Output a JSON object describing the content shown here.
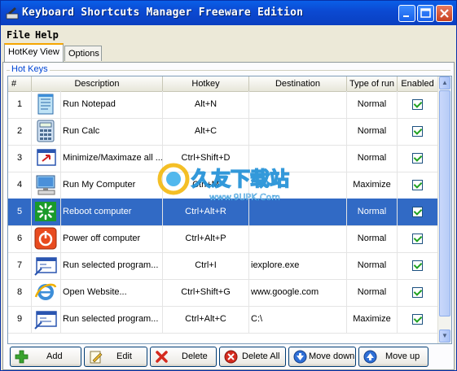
{
  "window": {
    "title": "Keyboard Shortcuts Manager Freeware Edition",
    "controls": [
      "minimize",
      "maximize",
      "close"
    ]
  },
  "menu": [
    {
      "label": "File"
    },
    {
      "label": "Help"
    }
  ],
  "tabs": [
    {
      "label": "HotKey View",
      "active": true
    },
    {
      "label": "Options",
      "active": false
    }
  ],
  "group": {
    "label": "Hot Keys"
  },
  "columns": [
    "#",
    "Description",
    "Hotkey",
    "Destination",
    "Type of run",
    "Enabled"
  ],
  "rows": [
    {
      "num": "1",
      "icon": "notepad-icon",
      "description": "Run Notepad",
      "hotkey": "Alt+N",
      "destination": "",
      "type": "Normal",
      "enabled": true,
      "selected": false
    },
    {
      "num": "2",
      "icon": "calculator-icon",
      "description": "Run Calc",
      "hotkey": "Alt+C",
      "destination": "",
      "type": "Normal",
      "enabled": true,
      "selected": false
    },
    {
      "num": "3",
      "icon": "minimize-window-icon",
      "description": "Minimize/Maximaze all ...",
      "hotkey": "Ctrl+Shift+D",
      "destination": "",
      "type": "Normal",
      "enabled": true,
      "selected": false
    },
    {
      "num": "4",
      "icon": "my-computer-icon",
      "description": "Run My Computer",
      "hotkey": "Ctrl+M",
      "destination": "",
      "type": "Maximize",
      "enabled": true,
      "selected": false
    },
    {
      "num": "5",
      "icon": "reboot-icon",
      "description": "Reboot computer",
      "hotkey": "Ctrl+Alt+R",
      "destination": "",
      "type": "Normal",
      "enabled": true,
      "selected": true
    },
    {
      "num": "6",
      "icon": "power-off-icon",
      "description": "Power off computer",
      "hotkey": "Ctrl+Alt+P",
      "destination": "",
      "type": "Normal",
      "enabled": true,
      "selected": false
    },
    {
      "num": "7",
      "icon": "run-program-icon",
      "description": "Run selected program...",
      "hotkey": "Ctrl+I",
      "destination": "iexplore.exe",
      "type": "Normal",
      "enabled": true,
      "selected": false
    },
    {
      "num": "8",
      "icon": "internet-explorer-icon",
      "description": "Open Website...",
      "hotkey": "Ctrl+Shift+G",
      "destination": "www.google.com",
      "type": "Normal",
      "enabled": true,
      "selected": false
    },
    {
      "num": "9",
      "icon": "run-program-icon",
      "description": "Run selected program...",
      "hotkey": "Ctrl+Alt+C",
      "destination": "C:\\",
      "type": "Maximize",
      "enabled": true,
      "selected": false
    }
  ],
  "buttons": [
    {
      "label": "Add",
      "icon": "add-icon"
    },
    {
      "label": "Edit",
      "icon": "edit-icon"
    },
    {
      "label": "Delete",
      "icon": "delete-icon"
    },
    {
      "label": "Delete All",
      "icon": "delete-all-icon"
    },
    {
      "label": "Move down",
      "icon": "move-down-icon"
    },
    {
      "label": "Move up",
      "icon": "move-up-icon"
    }
  ],
  "watermark": {
    "text": "久友下载站",
    "subtext": "www.9UPK.Com"
  },
  "colors": {
    "selection": "#316ac5",
    "titlebar": "#0a4fd6",
    "check": "#21a121"
  }
}
